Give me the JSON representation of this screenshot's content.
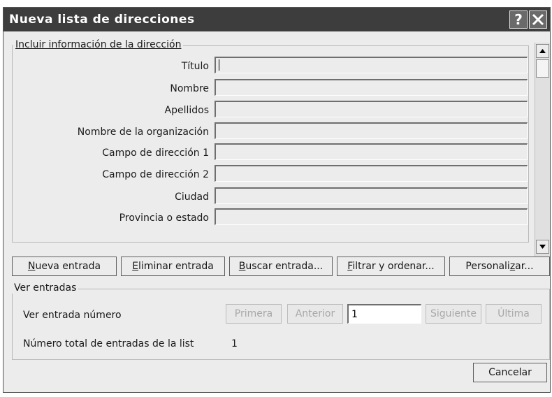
{
  "window": {
    "title": "Nueva lista de direcciones",
    "help_label": "?"
  },
  "address_group": {
    "label": "Incluir información de la dirección",
    "fields": [
      {
        "label": "Título",
        "value": ""
      },
      {
        "label": "Nombre",
        "value": ""
      },
      {
        "label": "Apellidos",
        "value": ""
      },
      {
        "label": "Nombre de la organización",
        "value": ""
      },
      {
        "label": "Campo de dirección 1",
        "value": ""
      },
      {
        "label": "Campo de dirección 2",
        "value": ""
      },
      {
        "label": "Ciudad",
        "value": ""
      },
      {
        "label": "Provincia o estado",
        "value": ""
      }
    ]
  },
  "actions": {
    "new_entry": {
      "mnemonic": "N",
      "rest": "ueva entrada"
    },
    "delete_entry": {
      "mnemonic": "E",
      "rest": "liminar entrada"
    },
    "find_entry": {
      "mnemonic": "B",
      "rest": "uscar entrada..."
    },
    "filter_sort": {
      "mnemonic": "F",
      "rest": "iltrar y ordenar..."
    },
    "customize": {
      "pre": "Personali",
      "mnemonic": "z",
      "rest": "ar..."
    }
  },
  "view_group": {
    "label": "Ver entradas",
    "entry_label": {
      "pre": "Ver entrada nú",
      "mnemonic": "m",
      "rest": "ero"
    },
    "first": "Primera",
    "previous": "Anterior",
    "entry_number": "1",
    "next": "Siguiente",
    "last": "Última",
    "total_label": "Número total de entradas de la list",
    "total_value": "1"
  },
  "cancel": "Cancelar"
}
